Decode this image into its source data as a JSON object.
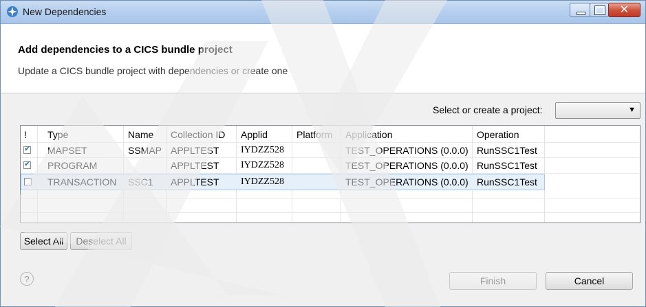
{
  "window": {
    "title": "New Dependencies"
  },
  "header": {
    "title": "Add dependencies to a CICS bundle project",
    "subtitle": "Update a CICS bundle project with dependencies or create one"
  },
  "project": {
    "label": "Select or create a project:",
    "selected": ""
  },
  "table": {
    "columns": [
      "!",
      "Type",
      "Name",
      "Collection ID",
      "Applid",
      "Platform",
      "Application",
      "Operation"
    ],
    "rows": [
      {
        "checked": true,
        "type": "MAPSET",
        "name": "SSMAP",
        "collection_id": "APPLTEST",
        "applid": "IYDZZ528",
        "platform": "",
        "application": "TEST_OPERATIONS (0.0.0)",
        "operation": "RunSSC1Test"
      },
      {
        "checked": true,
        "type": "PROGRAM",
        "name": "",
        "collection_id": "APPLTEST",
        "applid": "IYDZZ528",
        "platform": "",
        "application": "TEST_OPERATIONS (0.0.0)",
        "operation": "RunSSC1Test"
      },
      {
        "checked": false,
        "type": "TRANSACTION",
        "name": "SSC1",
        "collection_id": "APPLTEST",
        "applid": "IYDZZ528",
        "platform": "",
        "application": "TEST_OPERATIONS (0.0.0)",
        "operation": "RunSSC1Test"
      }
    ]
  },
  "buttons": {
    "select_all": "Select All",
    "deselect_all": "Deselect All",
    "finish": "Finish",
    "cancel": "Cancel"
  },
  "colors": {
    "title_bar": "#b5cfee",
    "close_button": "#c0392b",
    "selection": "#e6f0fb"
  }
}
